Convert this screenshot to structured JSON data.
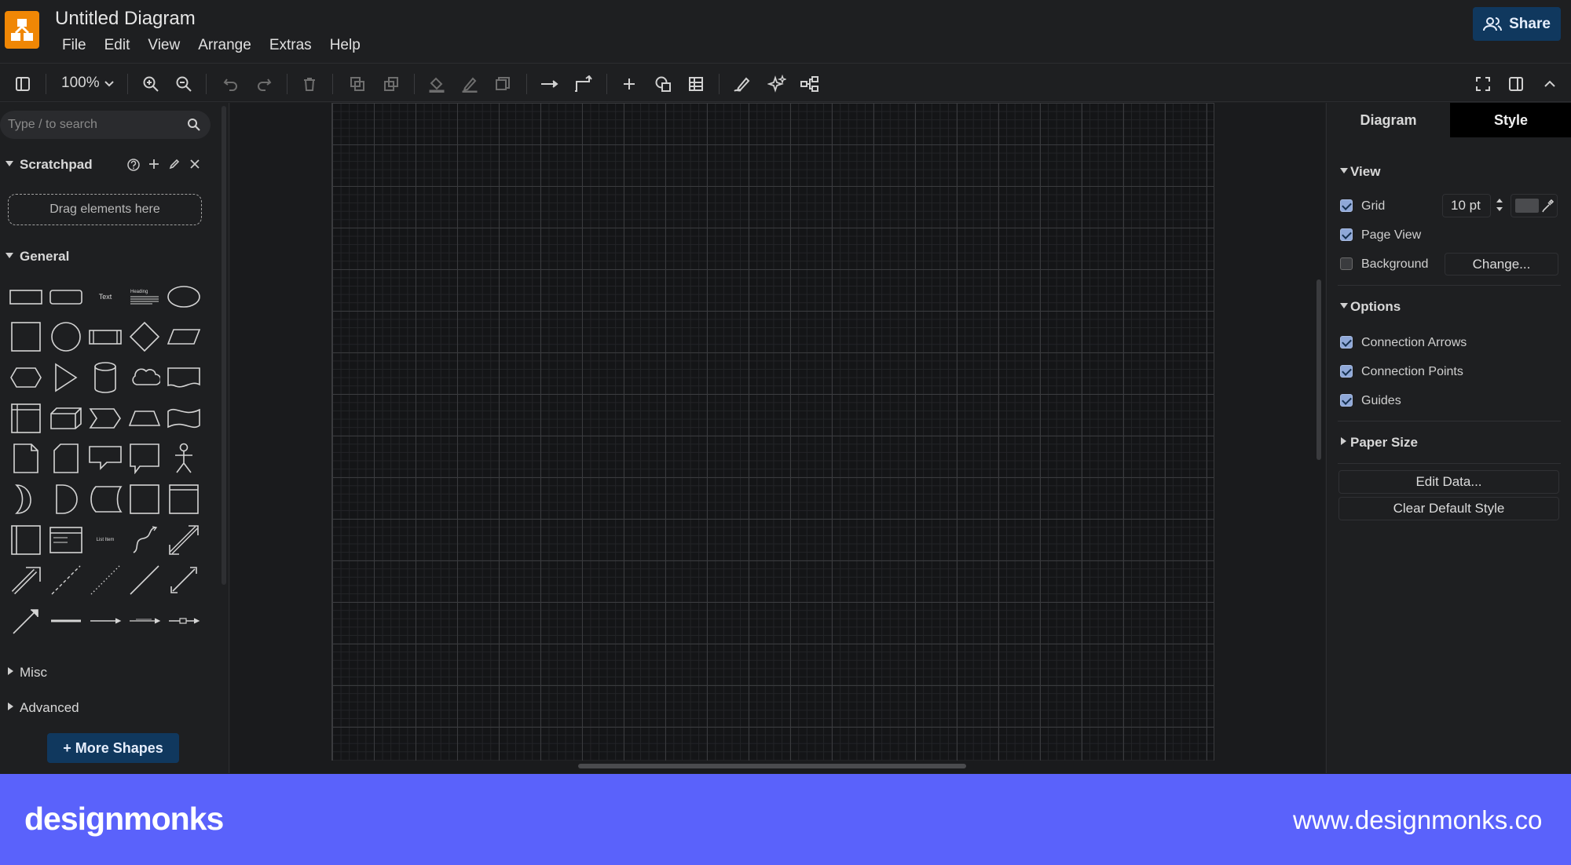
{
  "app": {
    "title": "Untitled Diagram",
    "share_label": "Share"
  },
  "menu": [
    "File",
    "Edit",
    "View",
    "Arrange",
    "Extras",
    "Help"
  ],
  "toolbar": {
    "zoom": "100%"
  },
  "left": {
    "search_placeholder": "Type / to search",
    "scratchpad_title": "Scratchpad",
    "drop_hint": "Drag elements here",
    "general_title": "General",
    "shape_text_label": "Text",
    "shape_heading_label": "Heading",
    "shape_listitem_label": "List Item",
    "misc_title": "Misc",
    "advanced_title": "Advanced",
    "more_shapes": "+ More Shapes"
  },
  "right": {
    "tabs": [
      "Diagram",
      "Style"
    ],
    "view_title": "View",
    "grid_label": "Grid",
    "grid_size": "10 pt",
    "page_view_label": "Page View",
    "background_label": "Background",
    "change_label": "Change...",
    "options_title": "Options",
    "connection_arrows_label": "Connection Arrows",
    "connection_points_label": "Connection Points",
    "guides_label": "Guides",
    "paper_size_title": "Paper Size",
    "edit_data_label": "Edit Data...",
    "clear_style_label": "Clear Default Style",
    "checkboxes": {
      "grid": true,
      "page_view": true,
      "background": false,
      "connection_arrows": true,
      "connection_points": true,
      "guides": true
    }
  },
  "footer": {
    "brand": "designmonks",
    "url": "www.designmonks.co"
  },
  "colors": {
    "accent": "#10385e",
    "logo": "#f08705",
    "footer": "#5a62fb",
    "checkbox": "#8fa8d8"
  }
}
